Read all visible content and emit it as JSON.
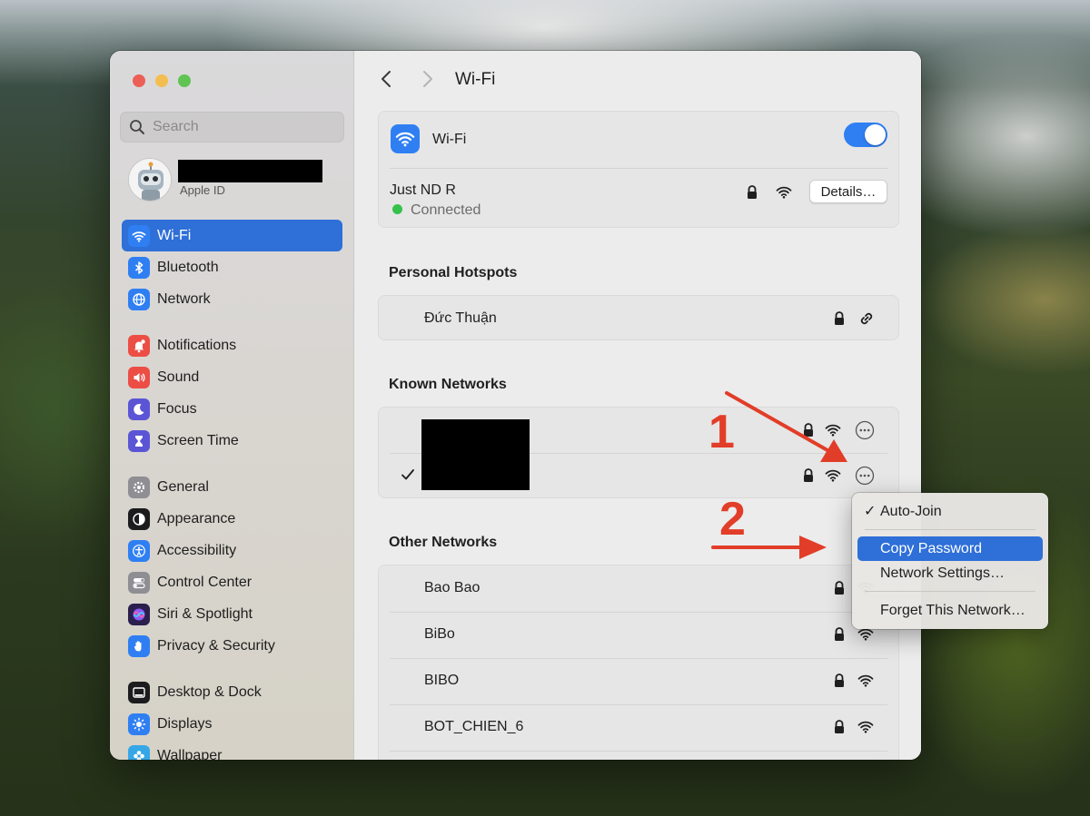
{
  "sidebar": {
    "search_placeholder": "Search",
    "account_sublabel": "Apple ID",
    "groups": [
      [
        {
          "label": "Wi-Fi",
          "icon": "wifi-icon",
          "color": "#2f7ff3",
          "active": true
        },
        {
          "label": "Bluetooth",
          "icon": "bluetooth-icon",
          "color": "#2f7ff3"
        },
        {
          "label": "Network",
          "icon": "globe-icon",
          "color": "#2f7ff3"
        }
      ],
      [
        {
          "label": "Notifications",
          "icon": "bell-icon",
          "color": "#ec4e45"
        },
        {
          "label": "Sound",
          "icon": "speaker-icon",
          "color": "#ec4e45"
        },
        {
          "label": "Focus",
          "icon": "moon-icon",
          "color": "#5b55d6"
        },
        {
          "label": "Screen Time",
          "icon": "hourglass-icon",
          "color": "#5b55d6"
        }
      ],
      [
        {
          "label": "General",
          "icon": "gear-icon",
          "color": "#8e8e93"
        },
        {
          "label": "Appearance",
          "icon": "appearance-icon",
          "color": "#1c1c1e"
        },
        {
          "label": "Accessibility",
          "icon": "accessibility-icon",
          "color": "#2f7ff3"
        },
        {
          "label": "Control Center",
          "icon": "toggles-icon",
          "color": "#8e8e93"
        },
        {
          "label": "Siri & Spotlight",
          "icon": "siri-icon",
          "color": "#2a1f4d"
        },
        {
          "label": "Privacy & Security",
          "icon": "hand-icon",
          "color": "#2f7ff3"
        }
      ],
      [
        {
          "label": "Desktop & Dock",
          "icon": "dock-icon",
          "color": "#1c1c1e"
        },
        {
          "label": "Displays",
          "icon": "sun-icon",
          "color": "#2f7ff3"
        },
        {
          "label": "Wallpaper",
          "icon": "flower-icon",
          "color": "#35a7e6"
        }
      ]
    ]
  },
  "main": {
    "title": "Wi-Fi",
    "wifi_label": "Wi-Fi",
    "wifi_enabled": true,
    "current_network": "Just ND R",
    "current_status": "Connected",
    "details_label": "Details…",
    "hotspots_heading": "Personal Hotspots",
    "hotspots": [
      {
        "name": "Đức Thuận"
      }
    ],
    "known_heading": "Known Networks",
    "other_heading": "Other Networks",
    "other_networks": [
      {
        "name": "Bao Bao"
      },
      {
        "name": "BiBo"
      },
      {
        "name": "BIBO"
      },
      {
        "name": "BOT_CHIEN_6"
      }
    ]
  },
  "context_menu": {
    "auto_join": "Auto-Join",
    "copy_password": "Copy Password",
    "network_settings": "Network Settings…",
    "forget": "Forget This Network…"
  },
  "annotations": {
    "one": "1",
    "two": "2",
    "color": "#e23d28"
  }
}
